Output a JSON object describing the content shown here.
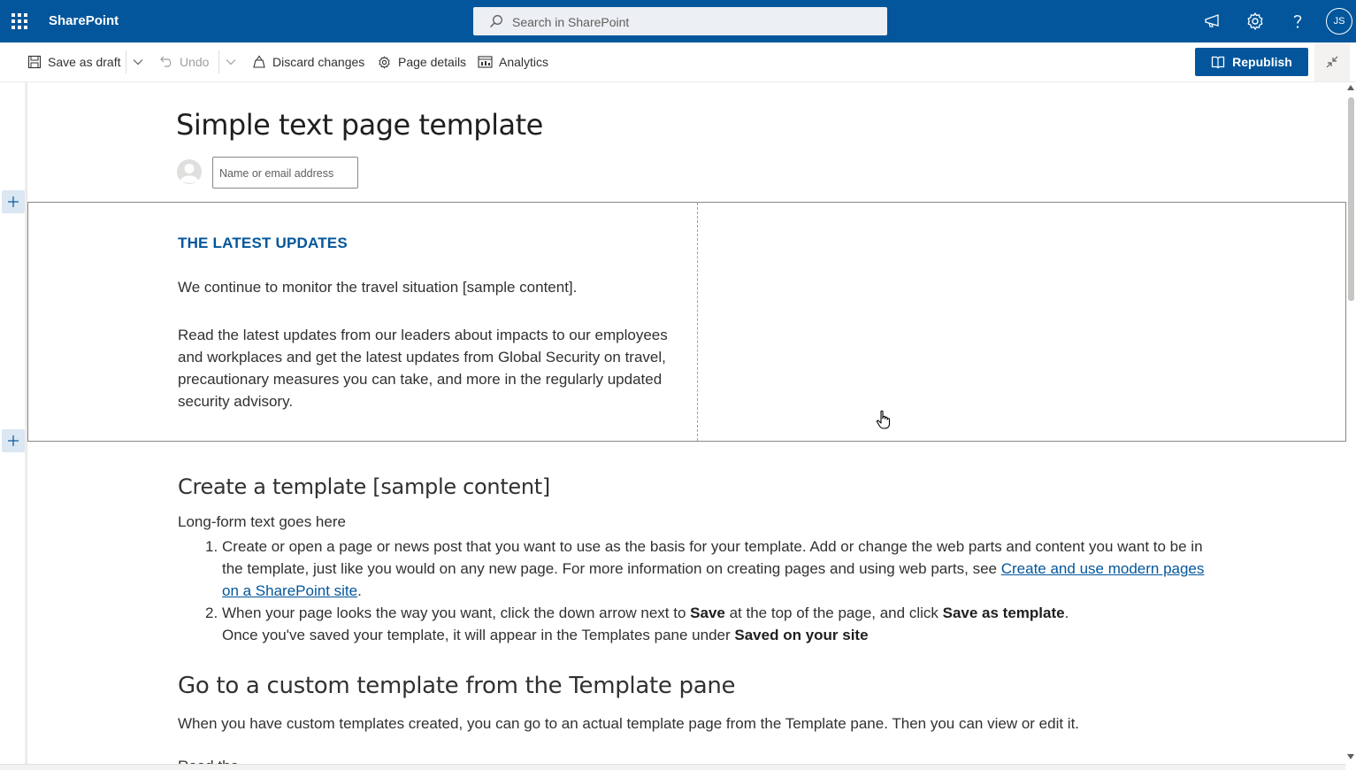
{
  "suite": {
    "brand": "SharePoint",
    "search_placeholder": "Search in SharePoint",
    "user_initials": "JS"
  },
  "toolbar": {
    "save_as_draft": "Save as draft",
    "undo": "Undo",
    "discard_changes": "Discard changes",
    "page_details": "Page details",
    "analytics": "Analytics",
    "republish": "Republish"
  },
  "page": {
    "title": "Simple text page template",
    "author_placeholder": "Name or email address"
  },
  "section1": {
    "heading": "THE LATEST UPDATES",
    "paragraph1": "We continue to monitor the travel situation [sample content].",
    "paragraph2": "Read the latest updates from our leaders about impacts to our employees and workplaces and get the latest updates from Global Security on travel, precautionary measures you can take, and more in the regularly updated security advisory."
  },
  "section2": {
    "heading": "Create a template [sample content]",
    "intro": "Long-form text goes here",
    "items": [
      {
        "num": "1.",
        "text_before_link": "Create or open a page or news post that you want to use as the basis for your template. Add or change the web parts and content you want to be in the template, just like you would on any new page. For more information on creating pages and using web parts, see ",
        "link": "Create and use modern pages on a SharePoint site",
        "text_after_link": "."
      },
      {
        "num": "2.",
        "text1": "When your page looks the way you want, click the down arrow next to ",
        "bold1": "Save",
        "text2": " at the top of the page, and click ",
        "bold2": "Save as template",
        "text3": ".",
        "line2_text": "Once you've saved your template, it will appear in the Templates pane under ",
        "line2_bold": "Saved on your site"
      }
    ]
  },
  "section3": {
    "heading": "Go to a custom template from the Template pane",
    "paragraph": "When you have custom templates created, you can go to an actual template page from the Template pane. Then you can view or edit it.",
    "cut_text": "Read the"
  },
  "colors": {
    "suite_bar": "#03569b",
    "accent": "#03569b",
    "add_section_bg": "#dbe7f3"
  }
}
